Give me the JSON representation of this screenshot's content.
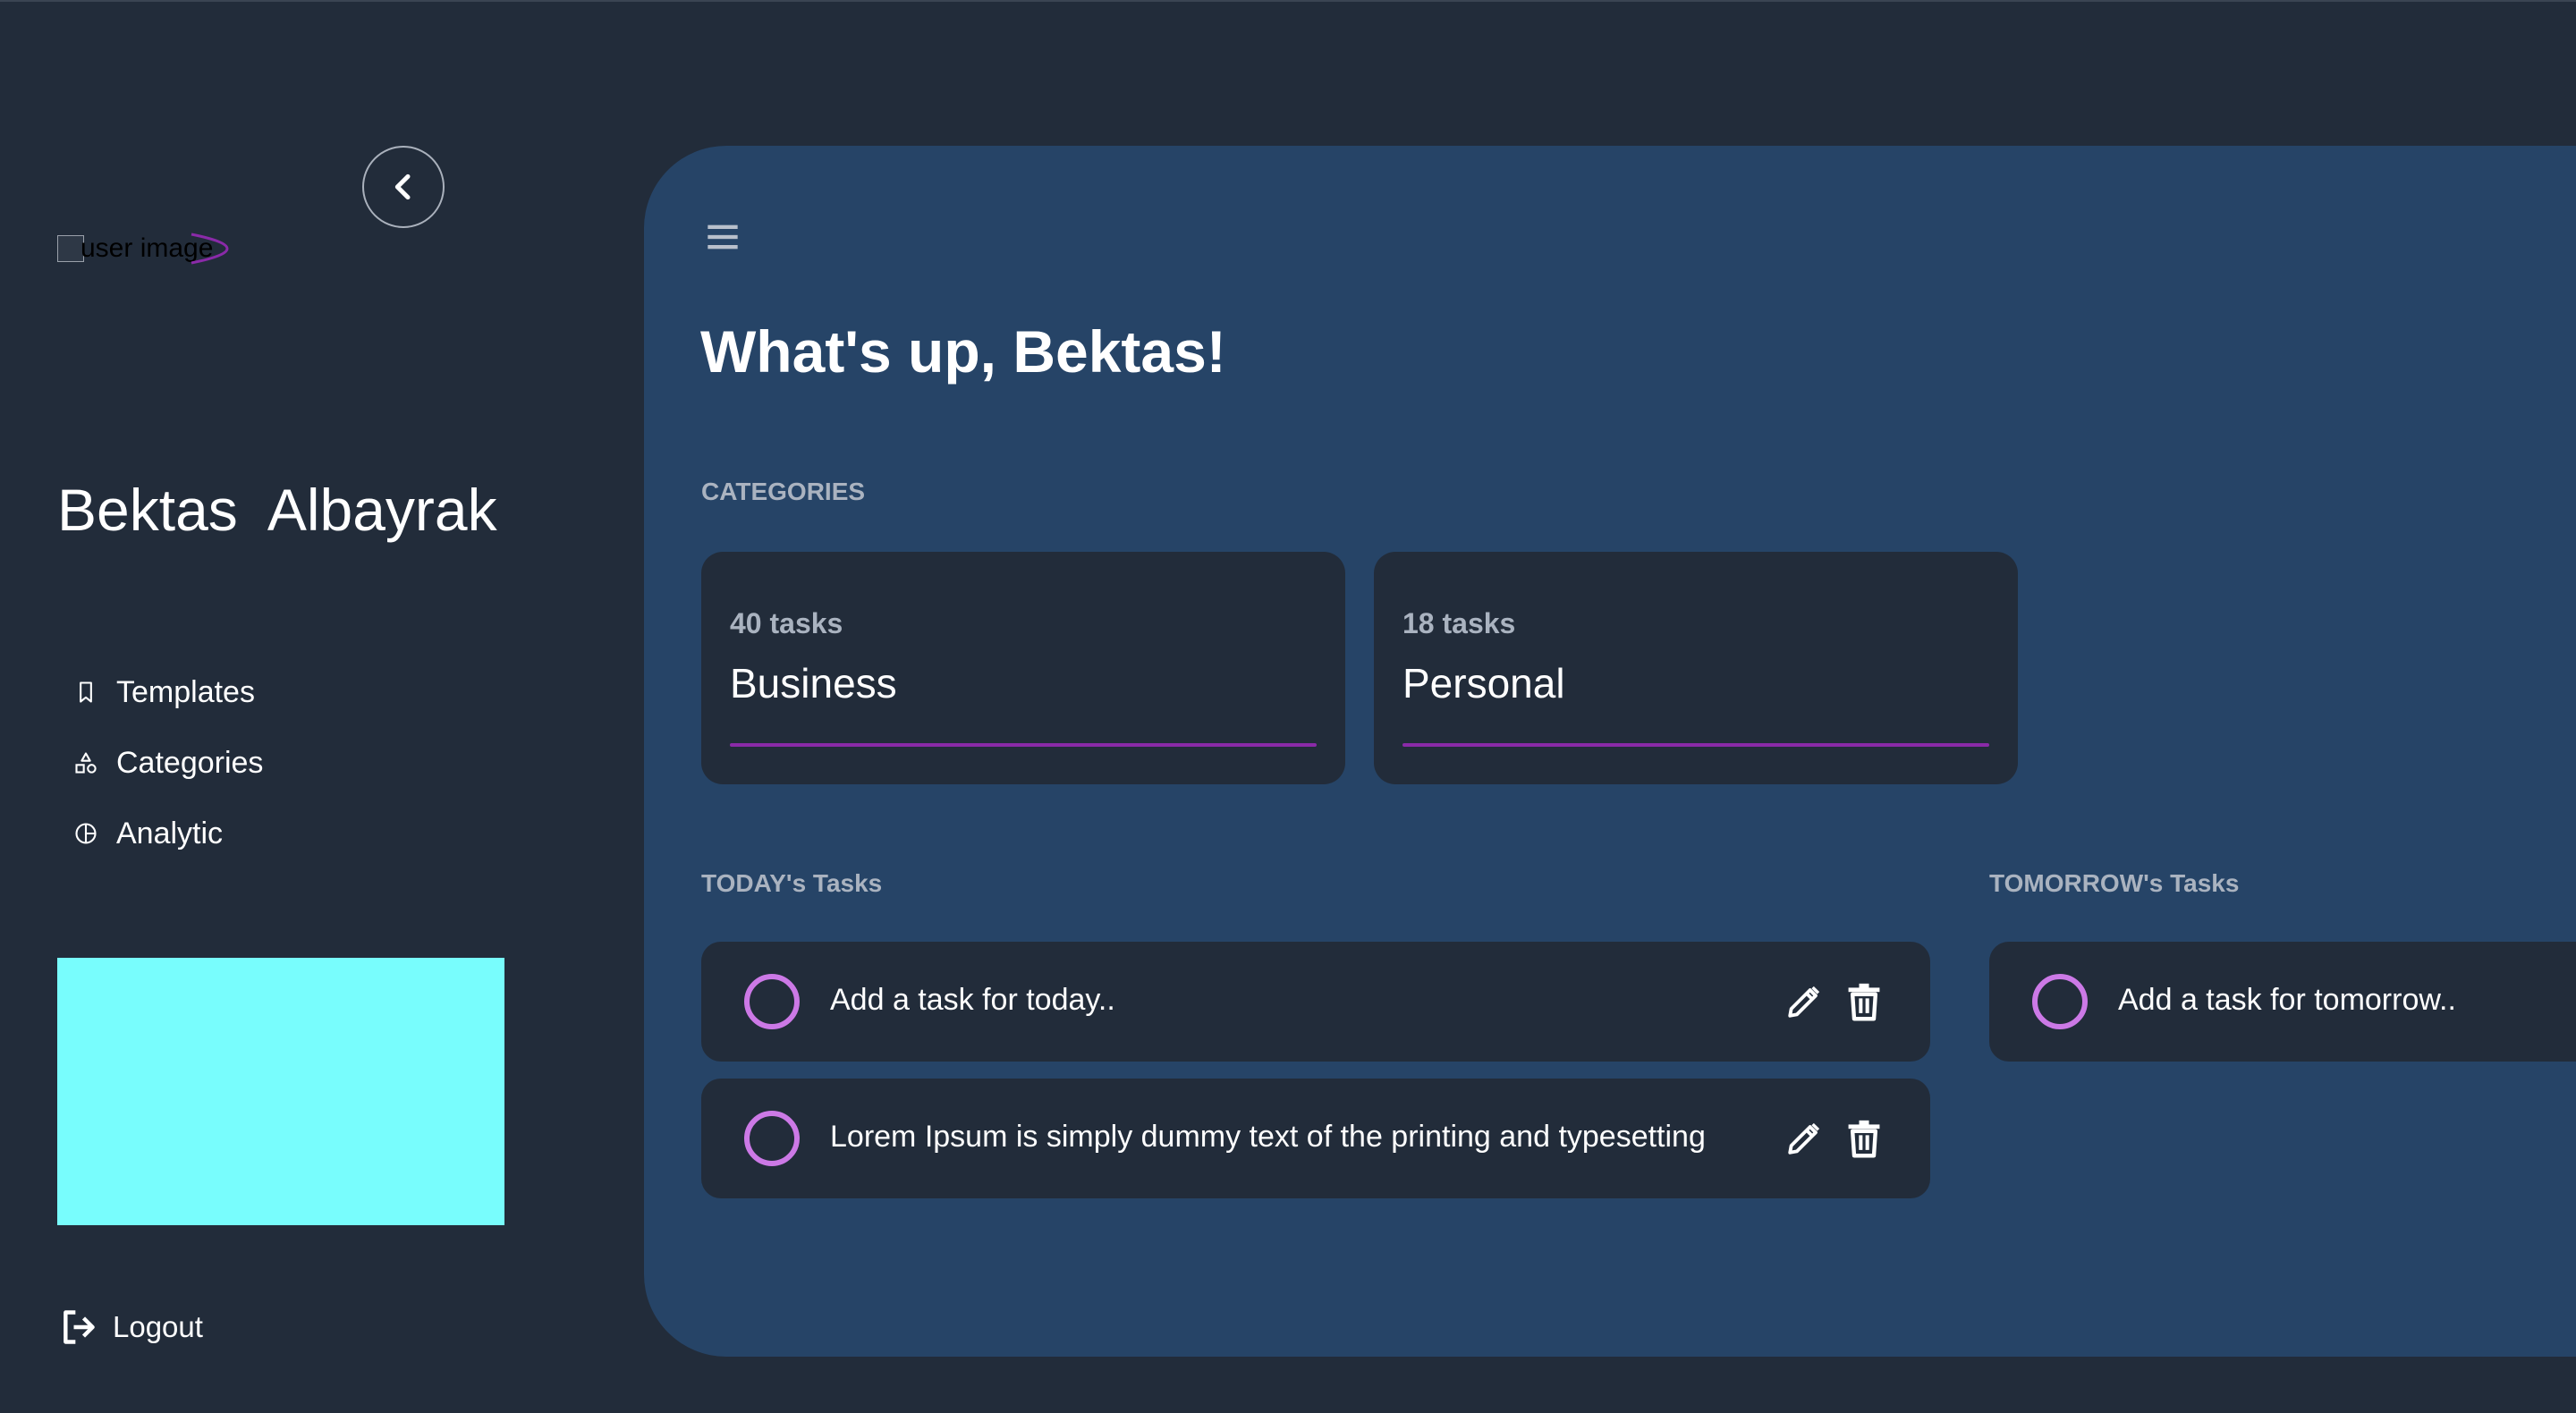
{
  "sidebar": {
    "avatar_alt": "user image",
    "user": {
      "first_name": "Bektas",
      "last_name": "Albayrak"
    },
    "nav": [
      {
        "label": "Templates",
        "icon": "bookmark-icon"
      },
      {
        "label": "Categories",
        "icon": "shapes-icon"
      },
      {
        "label": "Analytic",
        "icon": "pie-chart-icon"
      }
    ],
    "promo_color": "#78fdfd",
    "logout_label": "Logout"
  },
  "main": {
    "greeting": "What's up, Bektas!",
    "categories_label": "CATEGORIES",
    "categories": [
      {
        "count": "40 tasks",
        "name": "Business"
      },
      {
        "count": "18 tasks",
        "name": "Personal"
      }
    ],
    "today": {
      "label": "TODAY's Tasks",
      "tasks": [
        "Add a task for today..",
        "Lorem Ipsum is simply dummy text of the printing and typesetting"
      ]
    },
    "tomorrow": {
      "label": "TOMORROW's Tasks",
      "tasks": [
        "Add a task for tomorrow.."
      ]
    }
  },
  "colors": {
    "background": "#222c3a",
    "panel": "#264467",
    "card": "#222c3a",
    "accent": "#cc79e6",
    "progress": "#8a2aa8"
  }
}
